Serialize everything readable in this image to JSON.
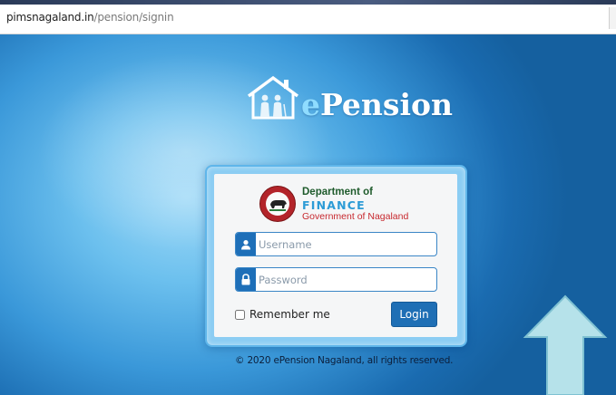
{
  "browser": {
    "url_host": "pimsnagaland.in",
    "url_path": "/pension/signin"
  },
  "brand": {
    "app_name_letter": "e",
    "app_name_rest": "Pension",
    "logo_icon": "house-with-people-icon",
    "primary_color": "#1f6fb5"
  },
  "department": {
    "line1": "Department of",
    "line2": "FINANCE",
    "line3": "Government of Nagaland",
    "emblem_icon": "nagaland-emblem-icon"
  },
  "form": {
    "username_placeholder": "Username",
    "username_value": "",
    "password_placeholder": "Password",
    "password_value": "",
    "username_icon": "user-icon",
    "password_icon": "lock-icon",
    "remember_label": "Remember me",
    "remember_checked": false,
    "login_label": "Login"
  },
  "footer": {
    "copyright": "© 2020 ePension Nagaland, all rights reserved."
  }
}
